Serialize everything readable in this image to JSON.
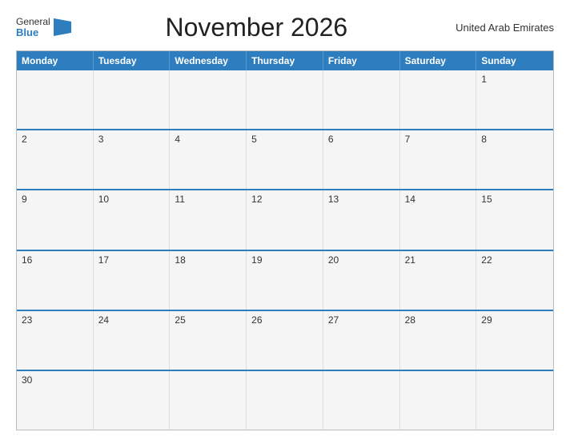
{
  "header": {
    "logo_general": "General",
    "logo_blue": "Blue",
    "title": "November 2026",
    "country": "United Arab Emirates"
  },
  "calendar": {
    "days_of_week": [
      "Monday",
      "Tuesday",
      "Wednesday",
      "Thursday",
      "Friday",
      "Saturday",
      "Sunday"
    ],
    "weeks": [
      [
        null,
        null,
        null,
        null,
        null,
        null,
        1
      ],
      [
        2,
        3,
        4,
        5,
        6,
        7,
        8
      ],
      [
        9,
        10,
        11,
        12,
        13,
        14,
        15
      ],
      [
        16,
        17,
        18,
        19,
        20,
        21,
        22
      ],
      [
        23,
        24,
        25,
        26,
        27,
        28,
        29
      ],
      [
        30,
        null,
        null,
        null,
        null,
        null,
        null
      ]
    ]
  }
}
